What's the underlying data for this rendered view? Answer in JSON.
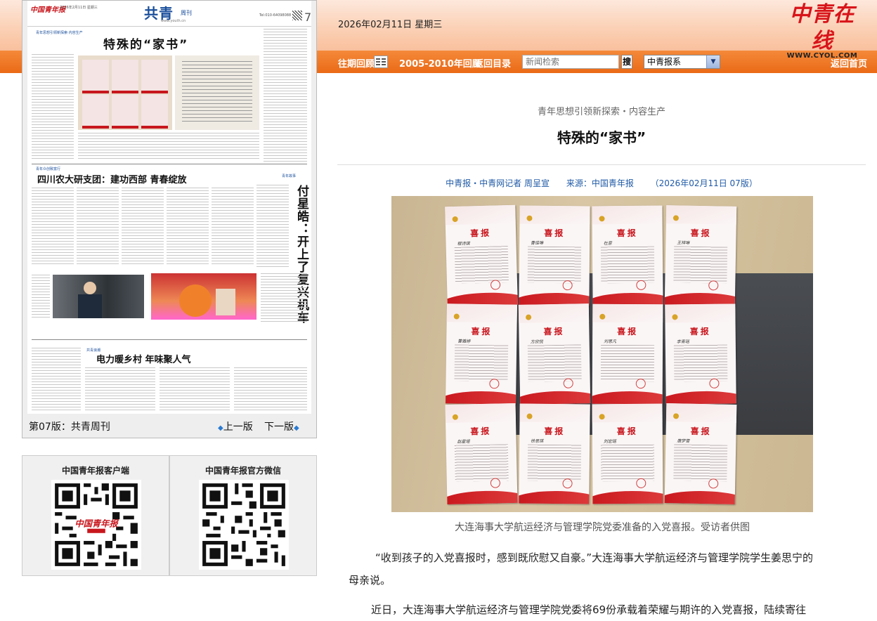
{
  "header": {
    "date": "2026年02月11日 星期三",
    "logo_text": "中青在线",
    "logo_url": "WWW.CYOL.COM",
    "brand_color": "#d8141a"
  },
  "nav": {
    "past_label": "往期回顾",
    "archive_label": "2005-2010年回顾",
    "back_label": "返回目录",
    "search_placeholder": "新闻检索",
    "search_button": "搜",
    "select_value": "中青报系",
    "home_label": "返回首页",
    "bar_color": "#ea6a16"
  },
  "newspaper": {
    "brand": "中国青年报",
    "date_line": "2026年2月11日 星期三",
    "title": "共青",
    "subtitle": "周刊",
    "url": "www.youth.cn",
    "tel": "Tel:010-64098088",
    "page_no": "7",
    "sections": {
      "top": "青年思想引领新探索·内容生产",
      "middle": "青年众创致富行",
      "right": "青年故事",
      "bottom": "共青浪潮"
    },
    "headlines": {
      "main": "特殊的“家书”",
      "second": "四川农大研支团：建功西部  青春绽放",
      "vertical": "付星皓：开上了复兴机车",
      "bottom": "电力暖乡村  年味聚人气"
    },
    "page_label": "第07版：共青周刊",
    "prev_label": "上一版",
    "next_label": "下一版"
  },
  "qr": [
    {
      "title": "中国青年报客户端"
    },
    {
      "title": "中国青年报官方微信"
    }
  ],
  "article": {
    "section": "青年思想引领新探索・内容生产",
    "title": "特殊的“家书”",
    "author": "中青报・中青网记者 周呈宣",
    "source": "来源：中国青年报",
    "date": "（2026年02月11日  07版）",
    "letter_title": "喜报",
    "letter_names": [
      "程诗琪",
      "曹佳琳",
      "杜意",
      "王梓琳",
      "曹雅婷",
      "方欣悦",
      "刘思凡",
      "李青瑶",
      "赵星瑶",
      "徐思琪",
      "刘宏瑶",
      "唐梦雪"
    ],
    "caption": "大连海事大学航运经济与管理学院党委准备的入党喜报。受访者供图",
    "para1_line1": "“收到孩子的入党喜报时，感到既欣慰又自豪。”大连海事大学航运经济与管理学院学生姜思宁的",
    "para1_line2": "母亲说。",
    "para2_line1": "近日，大连海事大学航运经济与管理学院党委将69份承载着荣耀与期许的入党喜报，陆续寄往"
  }
}
